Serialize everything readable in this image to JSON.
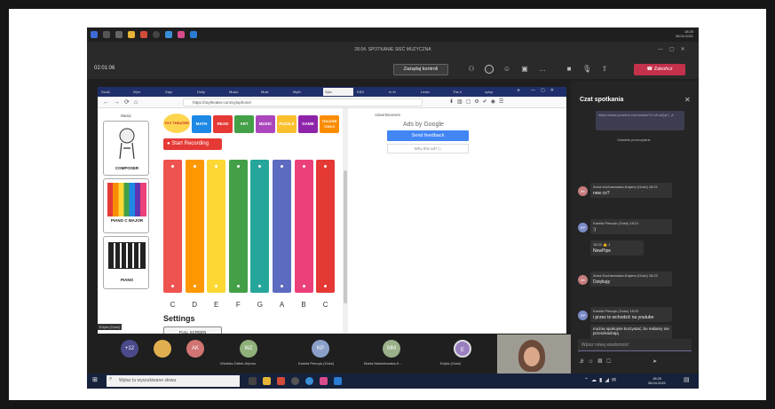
{
  "meeting": {
    "title": "28.04. SPOTKANIE SIEĆ MUZYCZNA",
    "timer": "02:01:06",
    "control_button": "Zażądaj kontroli",
    "leave_button": "Zakończ"
  },
  "remote_clock": {
    "time": "18:25",
    "date": "28.04.2021"
  },
  "browser": {
    "tabs": [
      "Szuki",
      "Wyn",
      "Zapr",
      "Dolly",
      "Music",
      "Musi",
      "Myth",
      "Xylo",
      "KBS",
      "In th",
      "Lectu",
      "The ri",
      "xylop"
    ],
    "active_tab": "Xylo",
    "url": "https://toytheater.com/xylophone/"
  },
  "page": {
    "sidebar_title": "Music",
    "instruments": [
      "COMPOSER",
      "PIANO C MAJOR",
      "PIANO"
    ],
    "logo": "TOY THEATER",
    "nav_tabs": [
      "MATH",
      "READ",
      "ART",
      "MUSIC",
      "PUZZLE",
      "GAME",
      "TEACHER TOOLS"
    ],
    "nav_colors": [
      "#1e88e5",
      "#e53935",
      "#43a047",
      "#ab47bc",
      "#fbc02d",
      "#8e24aa",
      "#fb8c00"
    ],
    "record_button": "Start Recording",
    "notes": [
      "C",
      "D",
      "E",
      "F",
      "G",
      "A",
      "B",
      "C"
    ],
    "bar_colors": [
      "#ef5350",
      "#ff9800",
      "#fdd835",
      "#43a047",
      "#26a69a",
      "#5c6bc0",
      "#ec407a",
      "#e53935"
    ],
    "settings_title": "Settings",
    "fullscreen_button": "FULL SCREEN"
  },
  "ad": {
    "label": "Advertisement",
    "ads_by": "Ads by Google",
    "send_feedback": "Send feedback",
    "why_ad": "Why this ad? ▷"
  },
  "presenter_tag": "Edyta (Gość)",
  "chat": {
    "title": "Czat spotkania",
    "link_preview": "https://www.youtube.com/watch?v=vH-aQqlY_A",
    "recent_separator": "Ostatnie przeczytane",
    "messages": [
      {
        "initials": "AK",
        "author": "Anna Kocharowska-Kapera (Gość) 18:21",
        "text": "new co?",
        "color": "#c67b7b"
      },
      {
        "initials": "KP",
        "author": "Kamila Pieczyk (Gość) 18:21",
        "text": ":)",
        "color": "#7b8bc6"
      },
      {
        "initials": "",
        "author": "18:22  👍 1",
        "text": "NewPipe",
        "color": ""
      },
      {
        "initials": "AK",
        "author": "Anna Kocharowska-Kapera (Gość) 18:22",
        "text": "Dziękuję",
        "color": "#c67b7b"
      },
      {
        "initials": "KP",
        "author": "Kamila Pieczyk (Gość) 18:22",
        "text": "i przez to wchodzić na youtube",
        "color": "#7b8bc6"
      },
      {
        "initials": "",
        "author": "",
        "text": "można spokojnie korzystać, bo reklamy nie przeszkadzają",
        "color": ""
      }
    ],
    "input_placeholder": "Wpisz nową wiadomość"
  },
  "participants": [
    {
      "initials": "+12",
      "name": "",
      "color": "#4a4a8a"
    },
    {
      "initials": "",
      "name": "",
      "color": "#e0b04f"
    },
    {
      "initials": "AK",
      "name": "",
      "color": "#d27474"
    },
    {
      "initials": "WZ",
      "name": "Wioletta Żółtek-Wynns",
      "color": "#8fb07a"
    },
    {
      "initials": "KP",
      "name": "Kamila Pieczyk (Gość)",
      "color": "#8ba0c9"
    },
    {
      "initials": "MM",
      "name": "Marta Markiełowska-K...",
      "color": "#9bb08a"
    },
    {
      "initials": "E",
      "name": "Edyta (Gość)",
      "color": "#9a7fc0"
    }
  ],
  "taskbar": {
    "search_placeholder": "Wpisz tu wyszukiwane słowa",
    "time": "18:25",
    "date": "28.04.2021"
  }
}
